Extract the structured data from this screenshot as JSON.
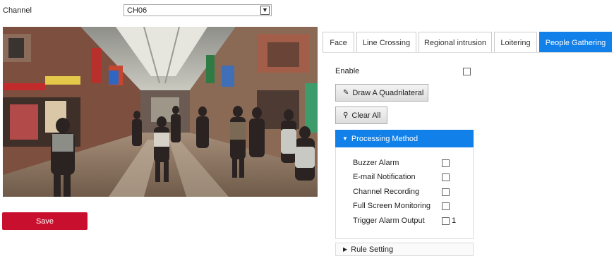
{
  "channel": {
    "label": "Channel",
    "value": "CH06"
  },
  "video": {
    "description_icon": "camera-feed"
  },
  "save_label": "Save",
  "tabs": [
    {
      "label": "Face",
      "active": false
    },
    {
      "label": "Line Crossing",
      "active": false
    },
    {
      "label": "Regional intrusion",
      "active": false
    },
    {
      "label": "Loitering",
      "active": false
    },
    {
      "label": "People Gathering",
      "active": true
    }
  ],
  "enable": {
    "label": "Enable",
    "checked": false
  },
  "buttons": {
    "draw": "Draw A Quadrilateral",
    "clear": "Clear All"
  },
  "processing": {
    "title": "Processing Method",
    "items": [
      {
        "label": "Buzzer Alarm",
        "checked": false
      },
      {
        "label": "E-mail Notification",
        "checked": false
      },
      {
        "label": "Channel Recording",
        "checked": false
      },
      {
        "label": "Full Screen Monitoring",
        "checked": false
      },
      {
        "label": "Trigger Alarm Output",
        "checked": false
      }
    ],
    "trigger_output_number": "1"
  },
  "rule_setting": {
    "title": "Rule Setting"
  },
  "colors": {
    "accent": "#1180e8",
    "save": "#c8102e"
  }
}
